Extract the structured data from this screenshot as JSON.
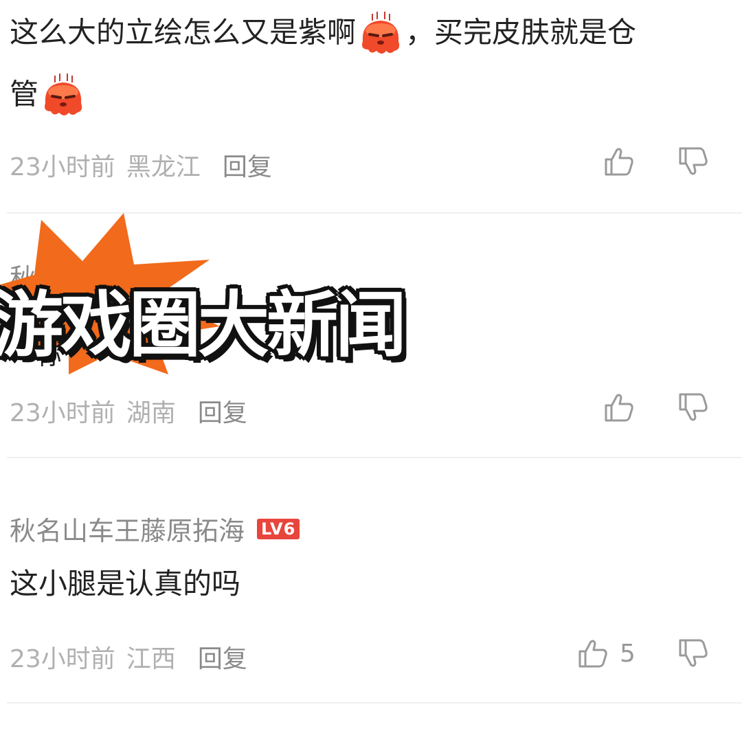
{
  "comments": [
    {
      "text_part1": "这么大的立绘怎么又是紫啊",
      "text_part2": "，买完皮肤就是仓",
      "text_line2": "管",
      "time": "23小时前",
      "location": "黑龙江",
      "reply_label": "回复",
      "like_count": ""
    },
    {
      "username_partial": "秋",
      "text_partial": "一称",
      "time": "23小时前",
      "location": "湖南",
      "reply_label": "回复",
      "like_count": ""
    },
    {
      "username": "秋名山车王藤原拓海",
      "level_badge": "LV6",
      "text": "这小腿是认真的吗",
      "time": "23小时前",
      "location": "江西",
      "reply_label": "回复",
      "like_count": "5"
    }
  ],
  "overlay": {
    "title": "游戏圈大新闻",
    "burst_color": "#f26a1b"
  },
  "colors": {
    "text": "#222222",
    "meta": "#b0b0b0",
    "badge": "#e8453c"
  },
  "icons": {
    "like": "thumbs-up-icon",
    "dislike": "thumbs-down-icon",
    "emoji": "sweating-octopus-emoji"
  }
}
